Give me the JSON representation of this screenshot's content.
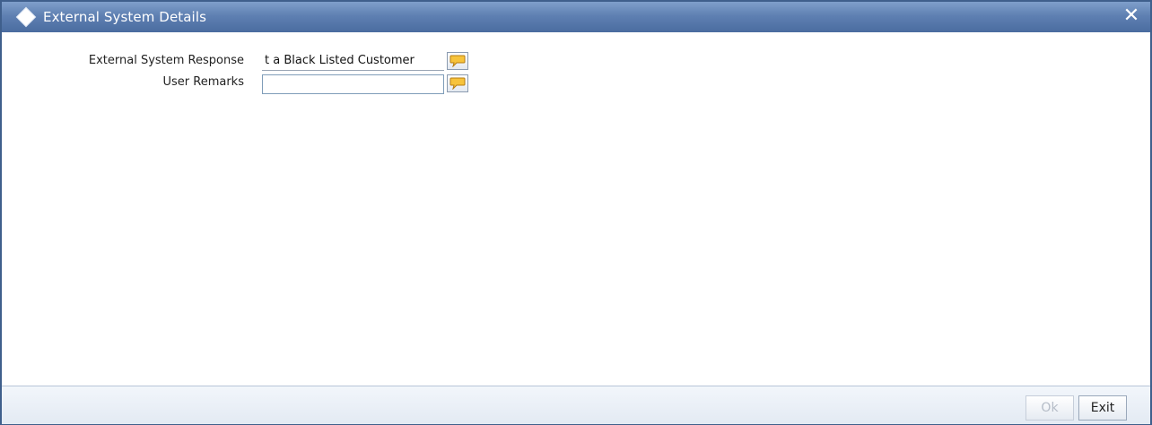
{
  "window": {
    "title": "External System Details",
    "close_symbol": "✕"
  },
  "form": {
    "external_system_response": {
      "label": "External System Response",
      "value": "t  a Black Listed Customer"
    },
    "user_remarks": {
      "label": "User Remarks",
      "value": ""
    }
  },
  "footer": {
    "ok_label": "Ok",
    "exit_label": "Exit"
  },
  "icons": {
    "title": "diamond-icon",
    "close": "close-icon",
    "edit_response": "speech-bubble-icon",
    "edit_remarks": "speech-bubble-icon"
  },
  "colors": {
    "titlebar": "#5f80b2",
    "bubble_fill": "#f7c33b"
  }
}
